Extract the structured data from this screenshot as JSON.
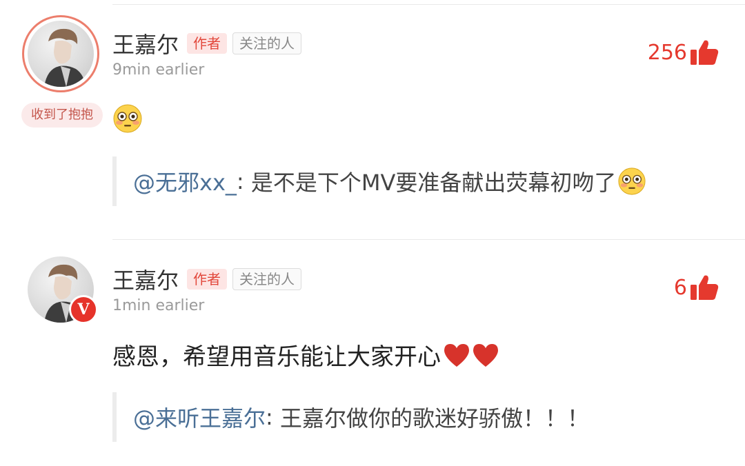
{
  "comments": [
    {
      "user": "王嘉尔",
      "author_tag": "作者",
      "follow_tag": "关注的人",
      "time": "9min earlier",
      "likes": "256",
      "badge": "收到了抱抱",
      "text": "",
      "reply_mention": "@无邪xx_",
      "reply_sep": ": ",
      "reply_text": "是不是下个MV要准备献出荧幕初吻了",
      "icons": [
        "flushed-face-emoji",
        "thumbs-up-icon"
      ]
    },
    {
      "user": "王嘉尔",
      "author_tag": "作者",
      "follow_tag": "关注的人",
      "time": "1min earlier",
      "likes": "6",
      "verified_mark": "V",
      "text": "感恩，希望用音乐能让大家开心",
      "reply_mention": "@来听王嘉尔",
      "reply_sep": ": ",
      "reply_text": "王嘉尔做你的歌迷好骄傲！！！",
      "icons": [
        "red-heart-emoji",
        "thumbs-up-icon"
      ]
    }
  ],
  "colors": {
    "accent": "#e5392e",
    "mention": "#4a6f96",
    "tag_bg": "#fde5e4"
  }
}
